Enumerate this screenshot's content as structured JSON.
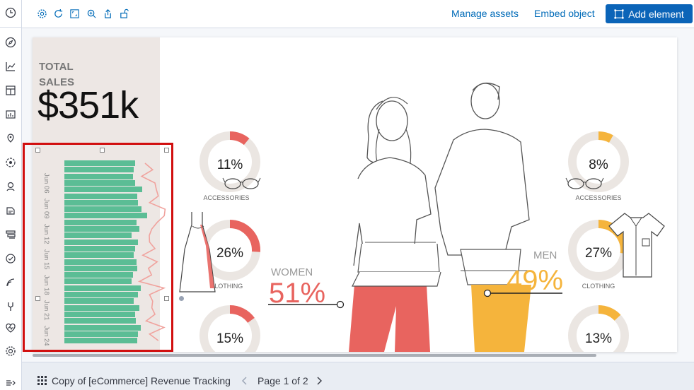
{
  "toolbar": {
    "manage_assets": "Manage assets",
    "embed_object": "Embed object",
    "add_element": "Add element"
  },
  "workpad": {
    "total_label": "TOTAL SALES",
    "total_value": "$351k",
    "date_ticks": [
      "Jun 06",
      "Jun 09",
      "Jun 12",
      "Jun 15",
      "Jun 18",
      "Jun 21",
      "Jun 24"
    ],
    "sales_bars": [
      100,
      98,
      97,
      100,
      110,
      103,
      104,
      109,
      117,
      102,
      106,
      95,
      104,
      100,
      98,
      102,
      103,
      97,
      95,
      108,
      104,
      98,
      106,
      100,
      101,
      108,
      104,
      103
    ],
    "women": {
      "label": "WOMEN",
      "pct": "51%",
      "color": "#e8645f"
    },
    "men": {
      "label": "MEN",
      "pct": "49%",
      "color": "#f5b43c"
    },
    "donuts_women": [
      {
        "pct": "11%",
        "value": 0.11,
        "category": "ACCESSORIES"
      },
      {
        "pct": "26%",
        "value": 0.26,
        "category": "CLOTHING"
      },
      {
        "pct": "15%",
        "value": 0.15,
        "category": ""
      }
    ],
    "donuts_men": [
      {
        "pct": "8%",
        "value": 0.08,
        "category": "ACCESSORIES"
      },
      {
        "pct": "27%",
        "value": 0.27,
        "category": "CLOTHING"
      },
      {
        "pct": "13%",
        "value": 0.13,
        "category": ""
      }
    ],
    "colors": {
      "donut_bg": "#ebe6e2",
      "bar": "#5bbd95",
      "selection": "#d10f0f"
    }
  },
  "footer": {
    "workpad_title": "Copy of [eCommerce] Revenue Tracking",
    "page_info": "Page 1 of 2"
  },
  "icons": [
    "clock-icon",
    "compass-icon",
    "chart-icon",
    "dashboard-icon",
    "canvas-icon",
    "maps-icon",
    "ml-icon",
    "graph-icon",
    "logs-icon",
    "apm-icon",
    "uptime-icon",
    "siem-icon",
    "dev-tools-icon",
    "monitoring-icon",
    "management-icon",
    "collapse-icon"
  ]
}
